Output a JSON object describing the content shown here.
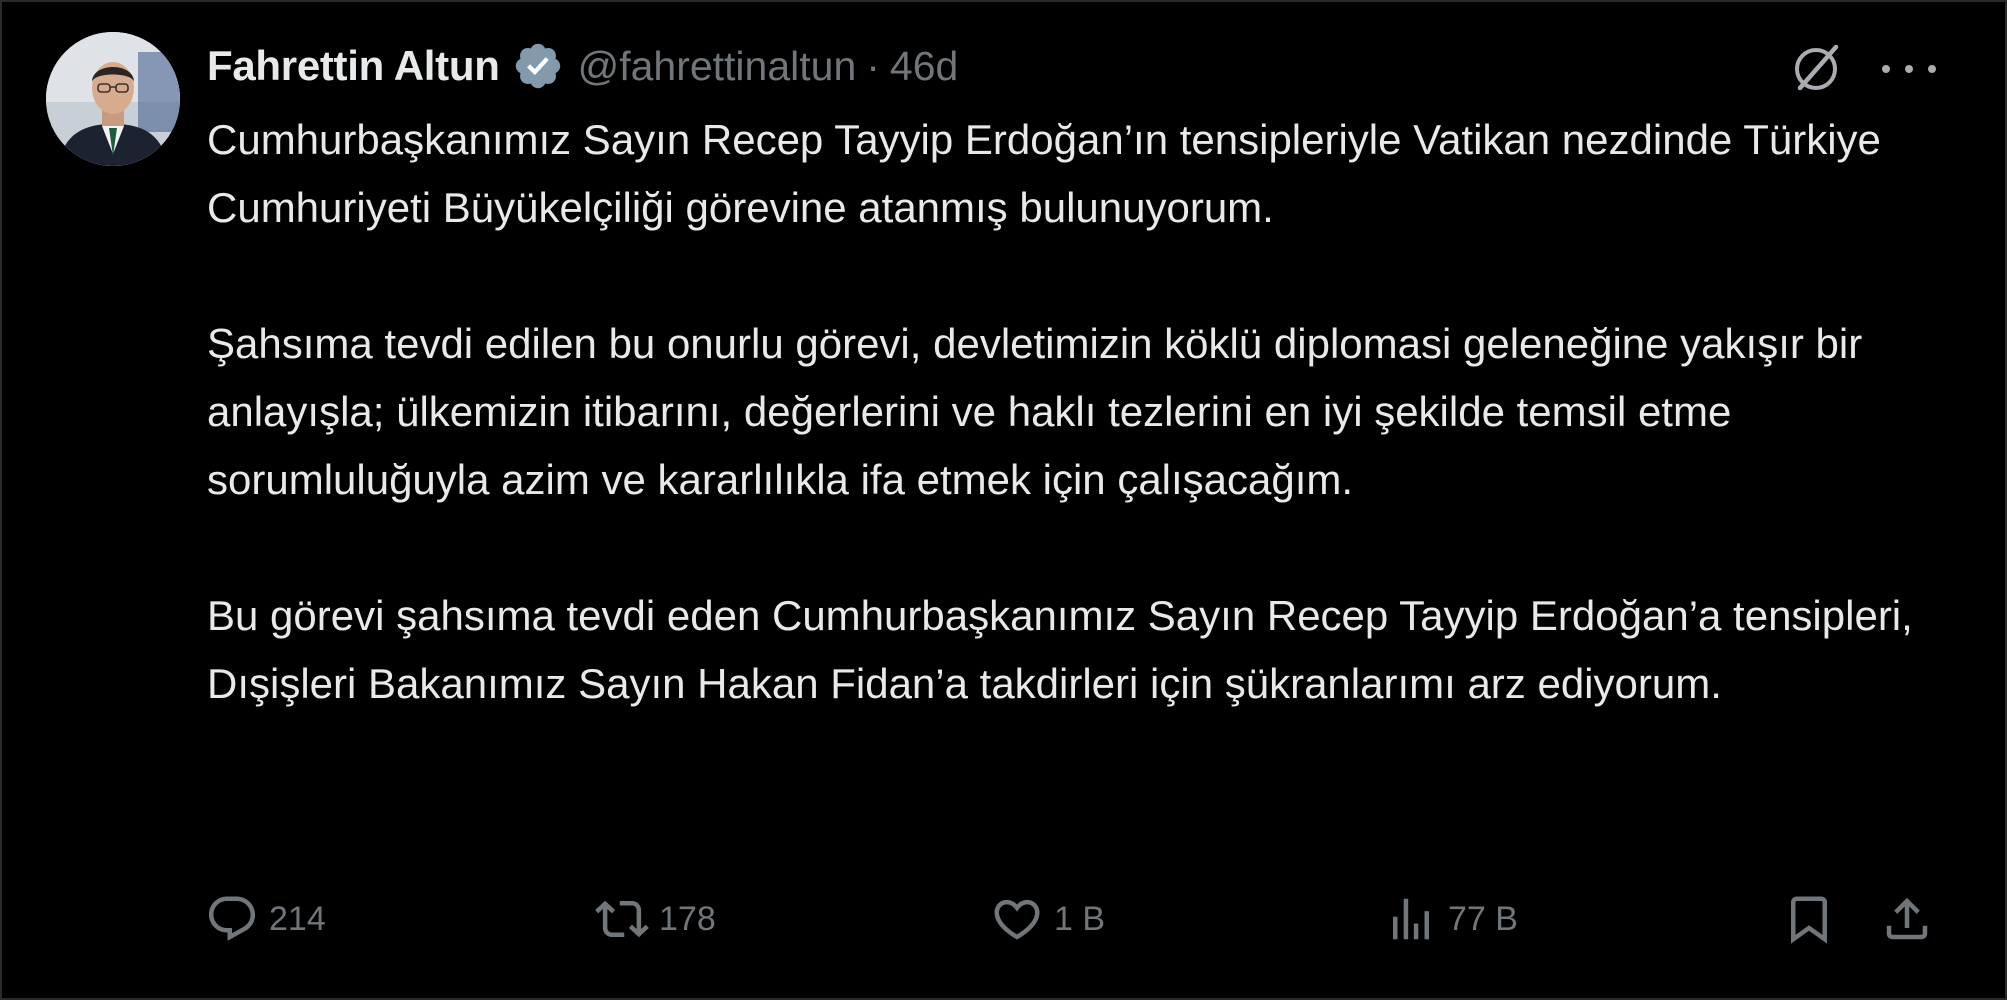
{
  "tweet": {
    "author": {
      "name": "Fahrettin Altun",
      "handle": "@fahrettinaltun",
      "separator": "·",
      "time": "46d",
      "verified_color": "#829aab"
    },
    "body": [
      "Cumhurbaşkanımız Sayın Recep Tayyip Erdoğan’ın tensipleriyle Vatikan nezdinde Türkiye Cumhuriyeti Büyükelçiliği görevine atanmış bulunuyorum.",
      "Şahsıma tevdi edilen bu onurlu görevi, devletimizin köklü diplomasi geleneğine yakışır bir anlayışla; ülkemizin itibarını, değerlerini ve haklı tezlerini en iyi şekilde temsil etme sorumluluğuyla azim ve kararlılıkla ifa etmek için çalışacağım.",
      "Bu görevi şahsıma tevdi eden Cumhurbaşkanımız Sayın Recep Tayyip Erdoğan’a tensipleri, Dışişleri Bakanımız Sayın Hakan Fidan’a takdirleri için şükranlarımı arz ediyorum."
    ],
    "actions": {
      "replies": "214",
      "reposts": "178",
      "likes": "1 B",
      "views": "77 B"
    },
    "icons": {
      "reply": "reply-icon",
      "repost": "repost-icon",
      "like": "heart-icon",
      "views": "views-icon",
      "bookmark": "bookmark-icon",
      "share": "share-icon",
      "grok": "grok-icon",
      "more": "more-icon",
      "verified": "verified-badge-icon"
    },
    "colors": {
      "background": "#000000",
      "text": "#e7e9ea",
      "secondary": "#71767b"
    }
  }
}
